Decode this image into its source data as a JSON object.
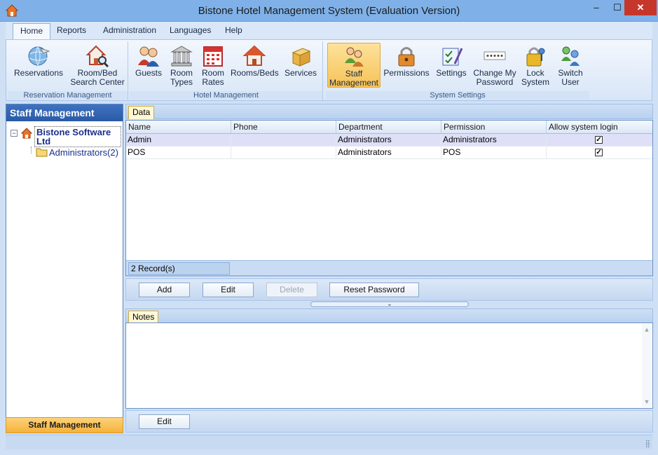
{
  "window": {
    "title": "Bistone Hotel Management System (Evaluation Version)",
    "min_label": "‒",
    "max_label": "☐",
    "close_label": "✕"
  },
  "ribbon": {
    "tabs": [
      {
        "label": "Home"
      },
      {
        "label": "Reports"
      },
      {
        "label": "Administration"
      },
      {
        "label": "Languages"
      },
      {
        "label": "Help"
      }
    ],
    "groups": [
      {
        "label": "Reservation Management",
        "buttons": [
          {
            "line1": "Reservations",
            "line2": "",
            "icon": "reservations-globe-icon"
          },
          {
            "line1": "Room/Bed",
            "line2": "Search Center",
            "icon": "house-search-icon"
          }
        ]
      },
      {
        "label": "Hotel Management",
        "buttons": [
          {
            "line1": "Guests",
            "line2": "",
            "icon": "guests-icon"
          },
          {
            "line1": "Room",
            "line2": "Types",
            "icon": "building-columns-icon"
          },
          {
            "line1": "Room",
            "line2": "Rates",
            "icon": "calendar-icon"
          },
          {
            "line1": "Rooms/Beds",
            "line2": "",
            "icon": "house-icon"
          },
          {
            "line1": "Services",
            "line2": "",
            "icon": "box-icon"
          }
        ]
      },
      {
        "label": "System Settings",
        "buttons": [
          {
            "line1": "Staff",
            "line2": "Management",
            "icon": "staff-icon"
          },
          {
            "line1": "Permissions",
            "line2": "",
            "icon": "padlock-icon"
          },
          {
            "line1": "Settings",
            "line2": "",
            "icon": "settings-checklist-icon"
          },
          {
            "line1": "Change My",
            "line2": "Password",
            "icon": "password-field-icon"
          },
          {
            "line1": "Lock",
            "line2": "System",
            "icon": "lock-key-icon"
          },
          {
            "line1": "Switch",
            "line2": "User",
            "icon": "switch-user-icon"
          }
        ]
      }
    ]
  },
  "left_panel": {
    "header": "Staff Management",
    "tree": {
      "root_label": "Bistone Software Ltd",
      "toggle": "−",
      "children": [
        {
          "label": "Administrators",
          "count": "(2)"
        }
      ]
    },
    "footer": "Staff Management"
  },
  "data_tab": {
    "label": "Data"
  },
  "grid": {
    "columns": [
      "Name",
      "Phone",
      "Department",
      "Permission",
      "Allow system login"
    ],
    "rows": [
      {
        "name": "Admin",
        "phone": "",
        "department": "Administrators",
        "permission": "Administrators",
        "allow_login": "✓"
      },
      {
        "name": "POS",
        "phone": "",
        "department": "Administrators",
        "permission": "POS",
        "allow_login": "✓"
      }
    ],
    "record_count": "2 Record(s)"
  },
  "actions": {
    "add": "Add",
    "edit": "Edit",
    "delete": "Delete",
    "reset_password": "Reset Password"
  },
  "splitter": {
    "glyph": "⌄"
  },
  "notes_tab": {
    "label": "Notes"
  },
  "notes": {
    "text": "",
    "scroll_up": "▲",
    "scroll_down": "▼",
    "edit": "Edit"
  },
  "colors": {
    "title_bar": "#7fb1e8",
    "panel_header": "#2a5aa5",
    "selected_ribbon": "#f7c257",
    "selected_row": "#dfe0f8",
    "close_button": "#c7362b"
  }
}
